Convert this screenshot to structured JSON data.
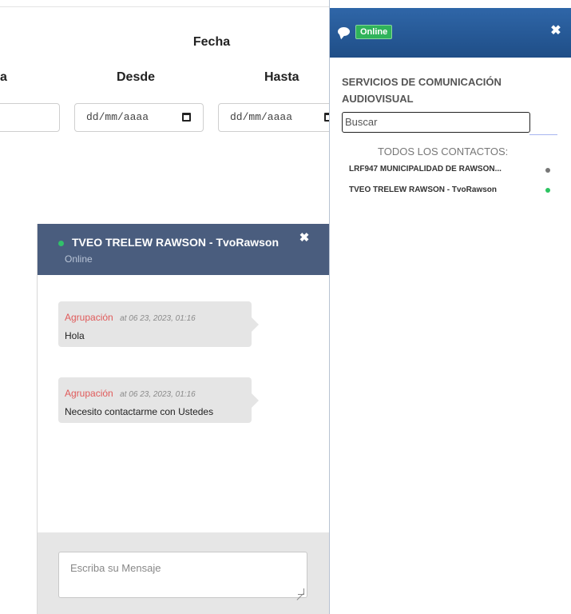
{
  "filters": {
    "fecha_label": "Fecha",
    "col_partial": "a",
    "desde_label": "Desde",
    "hasta_label": "Hasta",
    "desde_placeholder": "dd/mm/aaaa",
    "hasta_placeholder": "dd/mm/aaaa"
  },
  "chat": {
    "title": "TVEO TRELEW RAWSON - TvoRawson",
    "status": "Online",
    "close_symbol": "✖",
    "messages": [
      {
        "author": "Agrupación",
        "time": "at 06 23, 2023, 01:16",
        "text": "Hola"
      },
      {
        "author": "Agrupación",
        "time": "at 06 23, 2023, 01:16",
        "text": "Necesito contactarme con Ustedes"
      }
    ],
    "input_placeholder": "Escriba su Mensaje"
  },
  "panel": {
    "status_badge": "Online",
    "close_symbol": "✖",
    "section_title": "SERVICIOS DE COMUNICACIÓN AUDIOVISUAL",
    "search_placeholder": "Buscar",
    "contacts_header": "TODOS LOS CONTACTOS:",
    "contacts": [
      {
        "name": "LRF947 MUNICIPALIDAD DE RAWSON...",
        "status": "offline",
        "dot_color": "#777777"
      },
      {
        "name": "TVEO TRELEW RAWSON - TvoRawson",
        "status": "online",
        "dot_color": "#2cc461"
      }
    ],
    "header_color": "#24569a",
    "online_color": "#2fb35a"
  }
}
